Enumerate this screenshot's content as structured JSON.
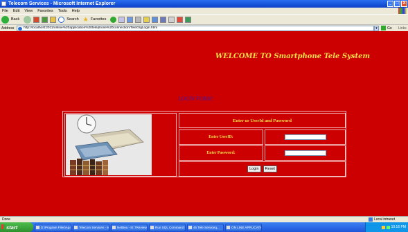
{
  "window": {
    "title": "Telecom Services - Microsoft Internet Explorer",
    "controls": [
      "_",
      "□",
      "X"
    ]
  },
  "menu": [
    "File",
    "Edit",
    "View",
    "Favorites",
    "Tools",
    "Help"
  ],
  "toolbar": {
    "back_label": "Back",
    "search_label": "Search",
    "favorites_label": "Favorites"
  },
  "address": {
    "label": "Address",
    "url": "http://localhost:2011/online%20application%20telephone%20connection/TeleOrgLogin.html",
    "go_label": "Go",
    "links_label": "Links"
  },
  "page": {
    "welcome": "WELCOME TO Smartphone Tele System",
    "login_heading": "LOGIN FORM:",
    "form_header": "Enter ur UserId and Password",
    "userid_label": "Enter UserID:",
    "password_label": "Enter Password:",
    "login_button": "Login",
    "reset_button": "Reset"
  },
  "status": {
    "text": "Done",
    "zone": "Local intranet"
  },
  "taskbar": {
    "start_label": "start",
    "tasks": [
      "D:\\Program Files\\Apa...",
      "Telecom Services - Mi...",
      "NetBea - IE 7Reviews",
      "Run SQL Command Line",
      "45 Tele Serviceq...",
      "ON LINE APPLICATIO..."
    ],
    "clock": "10:16 PM"
  },
  "colors": {
    "page_bg": "#cc0000",
    "welcome_text": "#f4e04a",
    "login_heading": "#3c1aa8",
    "table_border": "#f2b6b6"
  }
}
